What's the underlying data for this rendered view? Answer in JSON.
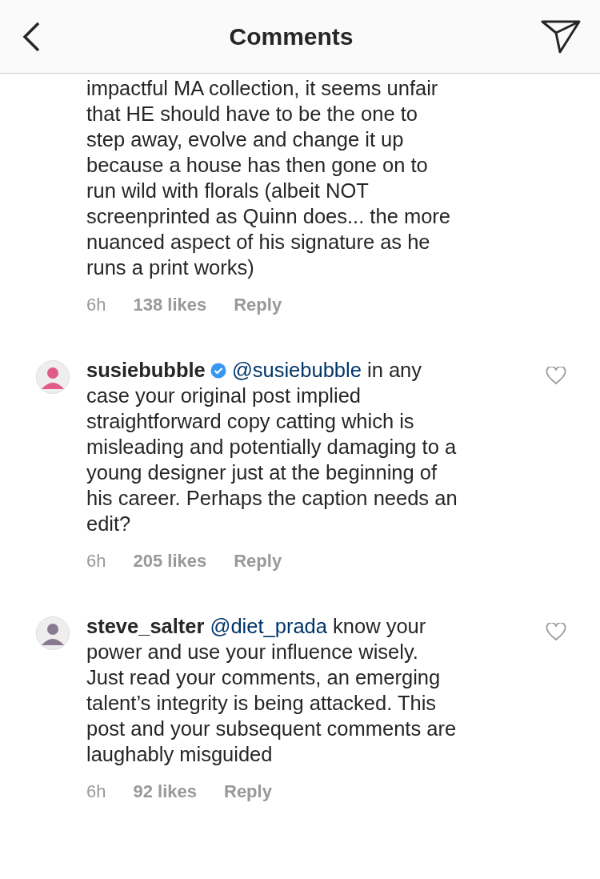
{
  "header": {
    "title": "Comments"
  },
  "comments": [
    {
      "kind": "continued",
      "text": "impactful MA collection, it seems unfair that HE should have to be the one to step away, evolve and change it up because a house has then gone on to run wild with florals (albeit NOT screenprinted as Quinn does... the more nuanced aspect of his signature as he runs a print works)",
      "time": "6h",
      "likes": "138 likes",
      "reply": "Reply"
    },
    {
      "kind": "comment",
      "username": "susiebubble",
      "verified": true,
      "mention": "@susiebubble",
      "text": " in any case your original post implied straightforward copy catting which is misleading and potentially damaging to a young designer just at the beginning of his career. Perhaps the caption needs an edit?",
      "time": "6h",
      "likes": "205 likes",
      "reply": "Reply"
    },
    {
      "kind": "comment",
      "username": "steve_salter",
      "verified": false,
      "mention": "@diet_prada",
      "text": " know your power and use your influence wisely. Just read your comments, an emerging talent’s integrity is being attacked. This post and your subsequent comments are laughably misguided",
      "time": "6h",
      "likes": "92 likes",
      "reply": "Reply"
    }
  ]
}
